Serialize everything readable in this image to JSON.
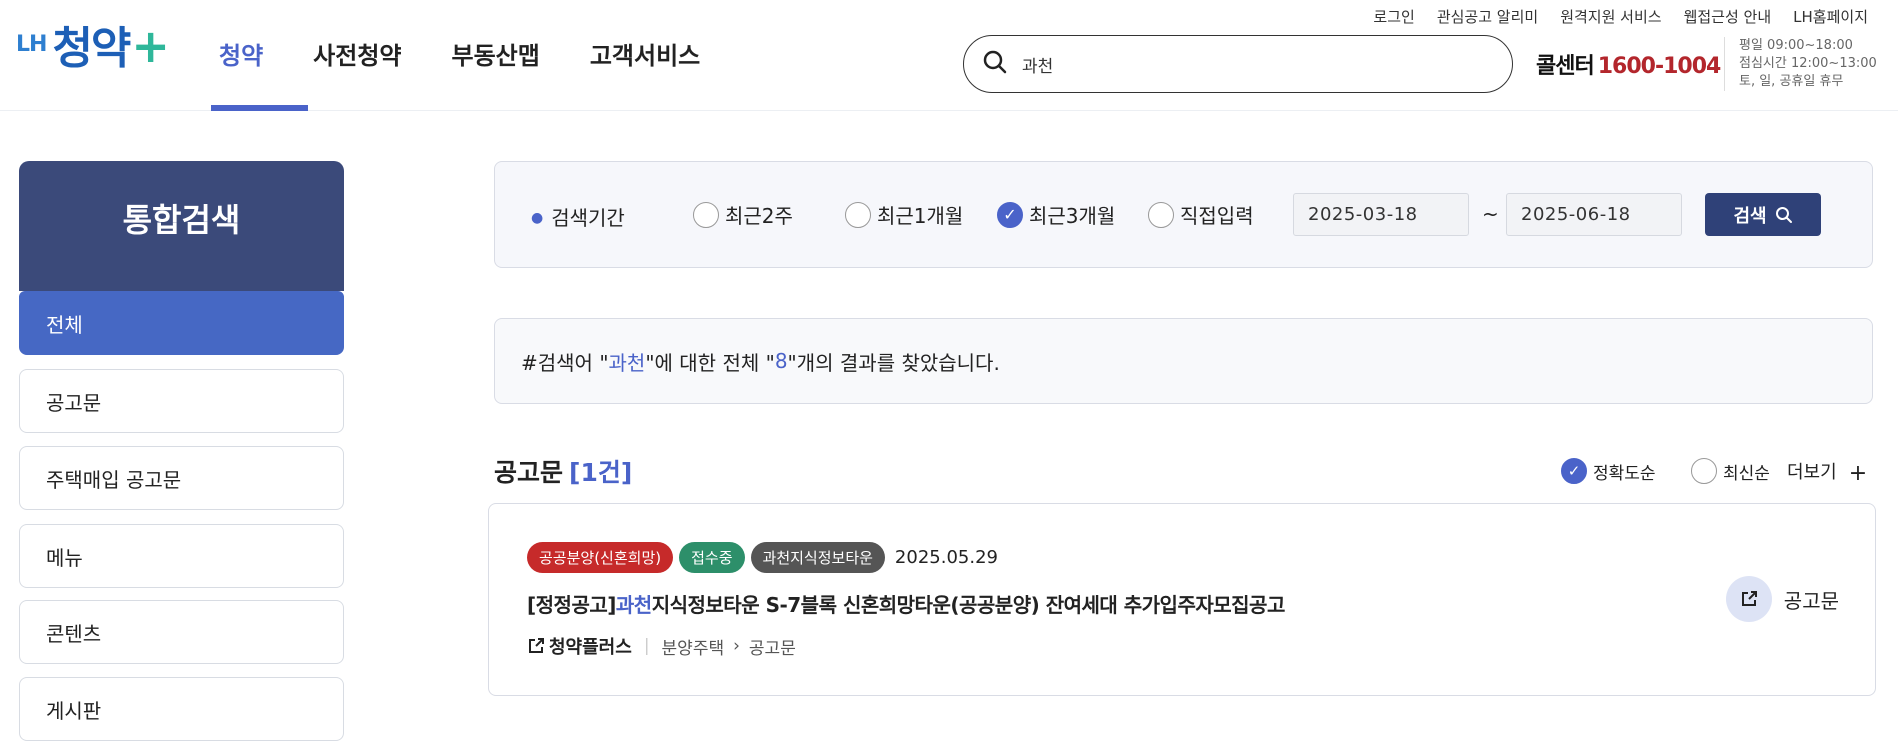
{
  "logo": {
    "prefix": "LH",
    "main": "청약",
    "plus": "+"
  },
  "gnb": [
    "청약",
    "사전청약",
    "부동산맵",
    "고객서비스"
  ],
  "util_links": [
    "로그인",
    "관심공고 알리미",
    "원격지원 서비스",
    "웹접근성 안내",
    "LH홈페이지"
  ],
  "search": {
    "value": "과천"
  },
  "callcenter": {
    "label": "콜센터",
    "number": "1600-1004",
    "hours": [
      "평일 09:00~18:00",
      "점심시간 12:00~13:00",
      "토, 일, 공휴일 휴무"
    ]
  },
  "sidebar": {
    "title": "통합검색",
    "items": [
      "전체",
      "공고문",
      "주택매입 공고문",
      "메뉴",
      "콘텐츠",
      "게시판"
    ]
  },
  "filter": {
    "label": "검색기간",
    "options": [
      "최근2주",
      "최근1개월",
      "최근3개월",
      "직접입력"
    ],
    "selected": "최근3개월",
    "start_date": "2025-03-18",
    "end_date": "2025-06-18",
    "tilde": "~",
    "search_button": "검색"
  },
  "summary": {
    "prefix": "#검색어 \"",
    "keyword": "과천",
    "middle": "\"에 대한 전체 \"",
    "count": "8",
    "suffix": "\"개의 결과를 찾았습니다."
  },
  "section": {
    "title": "공고문",
    "count": "[1건]",
    "sort_options": [
      "정확도순",
      "최신순"
    ],
    "sort_selected": "정확도순",
    "more": "더보기"
  },
  "result": {
    "badges": [
      "공공분양(신혼희망)",
      "접수중",
      "과천지식정보타운"
    ],
    "date": "2025.05.29",
    "title_prefix": "[정정공고]",
    "title_keyword": "과천",
    "title_rest": "지식정보타운 S-7블록 신혼희망타운(공공분양) 잔여세대 추가입주자모집공고",
    "site": "청약플러스",
    "category": "분양주택",
    "sub": "공고문",
    "doc_link": "공고문"
  },
  "colors": {
    "accent": "#4a63c9",
    "side_title": "#3b4a7a",
    "brand_red": "#b3262c"
  }
}
